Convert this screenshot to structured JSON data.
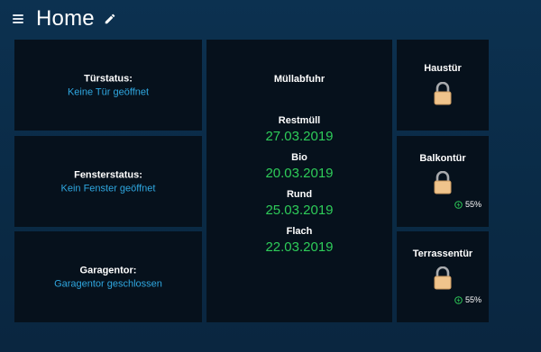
{
  "header": {
    "title": "Home"
  },
  "status_cards": [
    {
      "label": "Türstatus:",
      "value": "Keine Tür geöffnet"
    },
    {
      "label": "Fensterstatus:",
      "value": "Kein Fenster geöffnet"
    },
    {
      "label": "Garagentor:",
      "value": "Garagentor geschlossen"
    }
  ],
  "muellabfuhr": {
    "title": "Müllabfuhr",
    "items": [
      {
        "name": "Restmüll",
        "date": "27.03.2019"
      },
      {
        "name": "Bio",
        "date": "20.03.2019"
      },
      {
        "name": "Rund",
        "date": "25.03.2019"
      },
      {
        "name": "Flach",
        "date": "22.03.2019"
      }
    ]
  },
  "doors": [
    {
      "name": "Haustür",
      "icon": "lock-icon",
      "battery": ""
    },
    {
      "name": "Balkontür",
      "icon": "lock-icon",
      "battery": "55%"
    },
    {
      "name": "Terrassentür",
      "icon": "lock-icon",
      "battery": "55%"
    }
  ],
  "colors": {
    "background": "#0b2d4a",
    "card": "#06111c",
    "status_text": "#2fa7e0",
    "date_text": "#2ecc59",
    "lock": "#f0c48c",
    "battery_icon": "#2ecc59"
  }
}
